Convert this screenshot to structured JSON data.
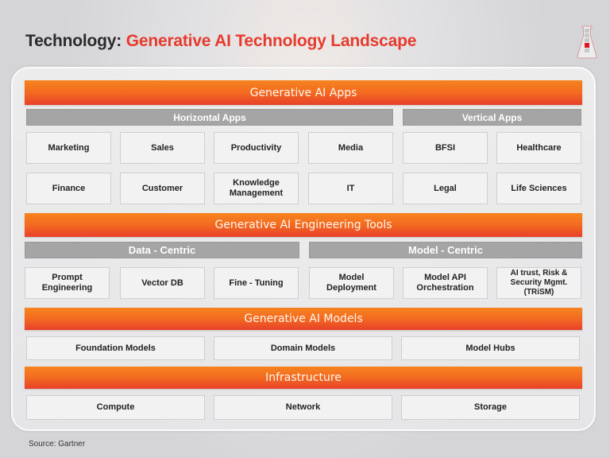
{
  "title": {
    "prefix": "Technology: ",
    "main": "Generative AI Technology Landscape"
  },
  "icon": "flask-progress-icon",
  "layers": {
    "apps": {
      "label": "Generative AI Apps",
      "horizontal": {
        "label": "Horizontal Apps",
        "row1": [
          "Marketing",
          "Sales",
          "Productivity",
          "Media"
        ],
        "row2": [
          "Finance",
          "Customer",
          "Knowledge\nManagement",
          "IT"
        ]
      },
      "vertical": {
        "label": "Vertical Apps",
        "row1": [
          "BFSI",
          "Healthcare"
        ],
        "row2": [
          "Legal",
          "Life Sciences"
        ]
      }
    },
    "tools": {
      "label": "Generative AI Engineering Tools",
      "data_centric": {
        "label": "Data - Centric",
        "items": [
          "Prompt\nEngineering",
          "Vector DB",
          "Fine - Tuning"
        ]
      },
      "model_centric": {
        "label": "Model - Centric",
        "items": [
          "Model\nDeployment",
          "Model API\nOrchestration",
          "AI trust, Risk &\nSecurity Mgmt.\n(TRiSM)"
        ]
      }
    },
    "models": {
      "label": "Generative AI Models",
      "items": [
        "Foundation Models",
        "Domain Models",
        "Model Hubs"
      ]
    },
    "infrastructure": {
      "label": "Infrastructure",
      "items": [
        "Compute",
        "Network",
        "Storage"
      ]
    }
  },
  "source": "Source: Gartner",
  "colors": {
    "accent_red": "#e63b2e",
    "bar_orange_top": "#f6841f",
    "bar_orange_bottom": "#e8402a",
    "subheader_gray": "#a5a5a5"
  }
}
